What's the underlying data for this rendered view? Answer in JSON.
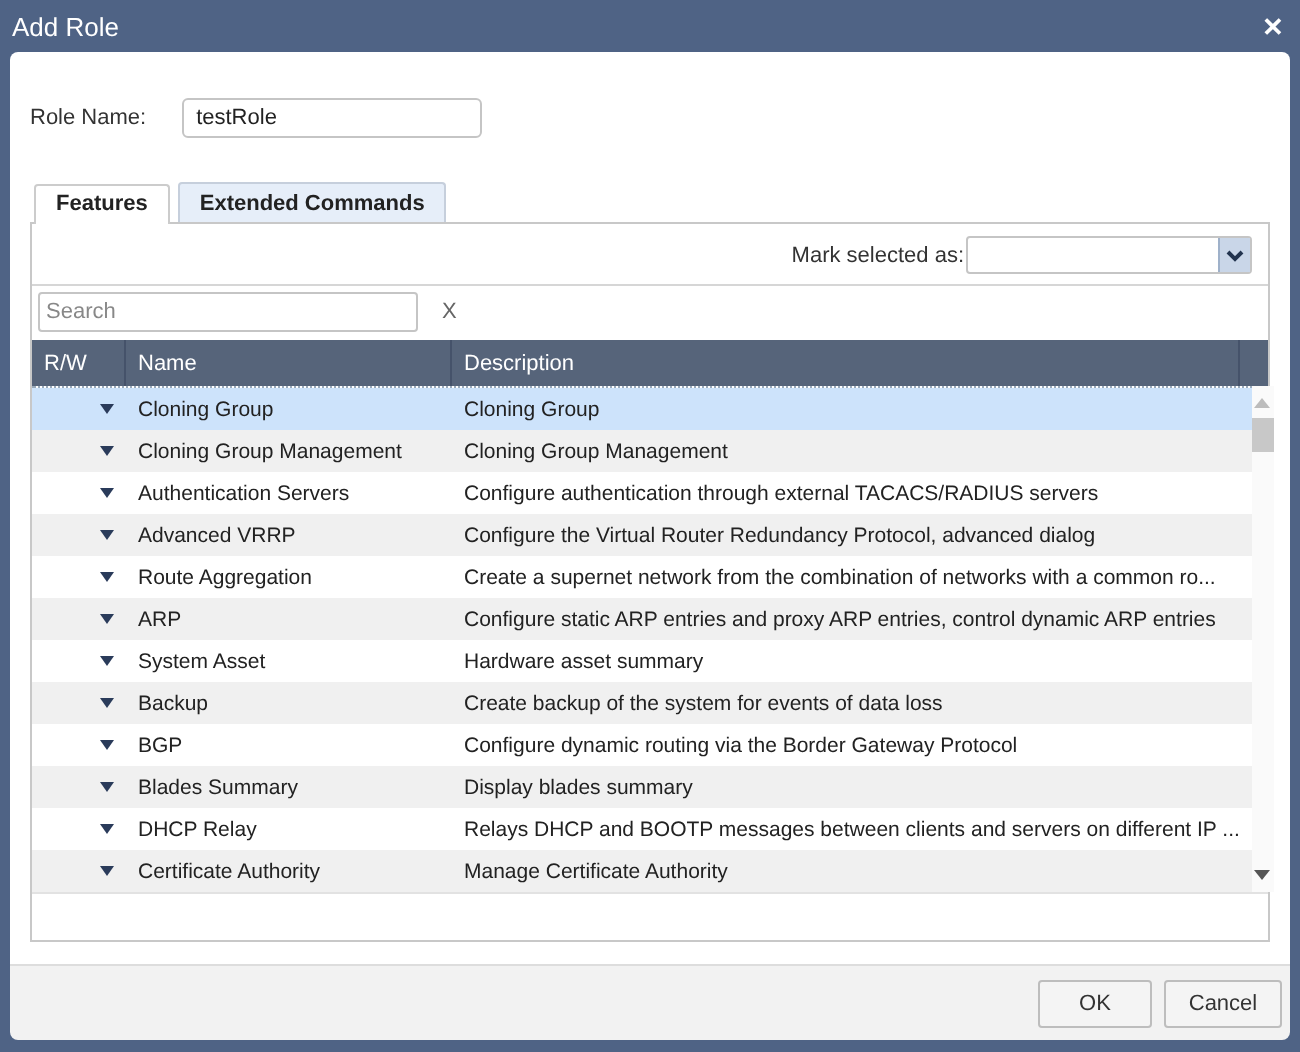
{
  "window": {
    "title": "Add Role",
    "close": "✕"
  },
  "role_name": {
    "label": "Role Name:",
    "value": "testRole"
  },
  "tabs": [
    {
      "label": "Features",
      "selected": true
    },
    {
      "label": "Extended Commands",
      "selected": false
    }
  ],
  "mark_selected": {
    "label": "Mark selected as:"
  },
  "search": {
    "placeholder": "Search",
    "clear": "X"
  },
  "table": {
    "columns": [
      "R/W",
      "Name",
      "Description"
    ],
    "rows": [
      {
        "name": "Cloning Group",
        "description": "Cloning Group",
        "selected": true
      },
      {
        "name": "Cloning Group Management",
        "description": "Cloning Group Management",
        "selected": false
      },
      {
        "name": "Authentication Servers",
        "description": "Configure authentication through external TACACS/RADIUS servers",
        "selected": false
      },
      {
        "name": "Advanced VRRP",
        "description": "Configure the Virtual Router Redundancy Protocol, advanced dialog",
        "selected": false
      },
      {
        "name": "Route Aggregation",
        "description": "Create a supernet network from the combination of networks with a common ro...",
        "selected": false
      },
      {
        "name": "ARP",
        "description": "Configure static ARP entries and proxy ARP entries, control dynamic ARP entries",
        "selected": false
      },
      {
        "name": "System Asset",
        "description": "Hardware asset summary",
        "selected": false
      },
      {
        "name": "Backup",
        "description": "Create backup of the system for events of data loss",
        "selected": false
      },
      {
        "name": "BGP",
        "description": "Configure dynamic routing via the Border Gateway Protocol",
        "selected": false
      },
      {
        "name": "Blades Summary",
        "description": "Display blades summary",
        "selected": false
      },
      {
        "name": "DHCP Relay",
        "description": "Relays DHCP and BOOTP messages between clients and servers on different IP ...",
        "selected": false
      },
      {
        "name": "Certificate Authority",
        "description": "Manage Certificate Authority",
        "selected": false
      }
    ]
  },
  "buttons": [
    "OK",
    "Cancel"
  ]
}
